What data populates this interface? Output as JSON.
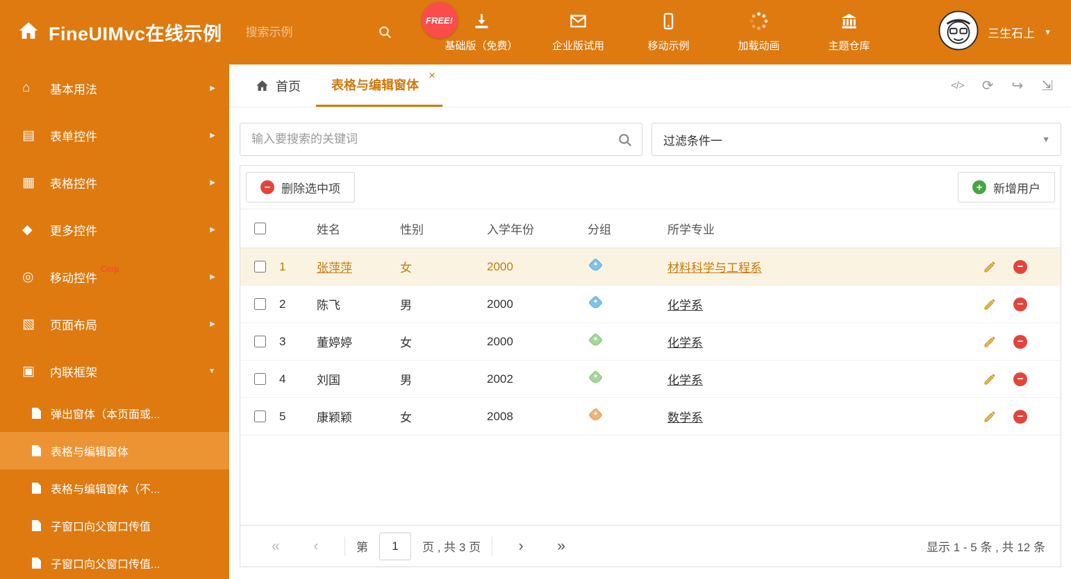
{
  "colors": {
    "accent_orange": "#DE7A10",
    "selected_item_bg": "#EC9434",
    "free_badge_red": "#FB4C4C",
    "delete_red": "#E2453C",
    "add_green": "#47A447",
    "selected_row_bg": "#FBF3E2",
    "selected_row_text": "#C67B0C"
  },
  "icons": {
    "home": "⌂",
    "form": "▤",
    "table": "▦",
    "more": "◆",
    "mobile": "◎",
    "layout": "▧",
    "frame": "▣",
    "chevron_right": "▶",
    "chevron_down": "▼",
    "caret_down": "▼",
    "close": "×",
    "code": "</>",
    "refresh": "⟳",
    "share": "↪",
    "expand": "⇲",
    "first": "«",
    "prev": "‹",
    "next": "›",
    "last": "»"
  },
  "header": {
    "title": "FineUIMvc在线示例",
    "search_placeholder": "搜索示例",
    "free_badge": "FREE!",
    "nav": [
      {
        "label": "基础版（免费）",
        "icon": "download-icon"
      },
      {
        "label": "企业版试用",
        "icon": "envelope-icon"
      },
      {
        "label": "移动示例",
        "icon": "mobile-icon"
      },
      {
        "label": "加载动画",
        "icon": "spinner-icon"
      },
      {
        "label": "主题仓库",
        "icon": "bank-icon"
      }
    ],
    "username": "三生石上"
  },
  "sidebar": {
    "items": [
      {
        "label": "基本用法"
      },
      {
        "label": "表单控件"
      },
      {
        "label": "表格控件"
      },
      {
        "label": "更多控件"
      },
      {
        "label": "移动控件",
        "badge": "Corp."
      },
      {
        "label": "页面布局"
      },
      {
        "label": "内联框架"
      }
    ],
    "subitems": [
      {
        "label": "弹出窗体（本页面或..."
      },
      {
        "label": "表格与编辑窗体"
      },
      {
        "label": "表格与编辑窗体（不..."
      },
      {
        "label": "子窗口向父窗口传值"
      },
      {
        "label": "子窗口向父窗口传值..."
      }
    ]
  },
  "tabs": [
    {
      "label": "首页"
    },
    {
      "label": "表格与编辑窗体"
    }
  ],
  "filters": {
    "search_placeholder": "输入要搜索的关键词",
    "filter_selected": "过滤条件一"
  },
  "toolbar": {
    "delete_label": "删除选中项",
    "add_label": "新增用户"
  },
  "grid": {
    "columns": [
      "姓名",
      "性别",
      "入学年份",
      "分组",
      "所学专业"
    ],
    "rows": [
      {
        "num": "1",
        "name": "张萍萍",
        "gender": "女",
        "year": "2000",
        "tag_class": "tag tag-blue",
        "major": "材料科学与工程系"
      },
      {
        "num": "2",
        "name": "陈飞",
        "gender": "男",
        "year": "2000",
        "tag_class": "tag tag-blue",
        "major": "化学系"
      },
      {
        "num": "3",
        "name": "董婷婷",
        "gender": "女",
        "year": "2000",
        "tag_class": "tag tag-green",
        "major": "化学系"
      },
      {
        "num": "4",
        "name": "刘国",
        "gender": "男",
        "year": "2002",
        "tag_class": "tag tag-green",
        "major": "化学系"
      },
      {
        "num": "5",
        "name": "康颖颖",
        "gender": "女",
        "year": "2008",
        "tag_class": "tag tag-orange",
        "major": "数学系"
      }
    ]
  },
  "pagination": {
    "prefix": "第",
    "current_page": "1",
    "suffix": "页 , 共 3 页",
    "summary": "显示 1 - 5 条 , 共 12 条"
  }
}
